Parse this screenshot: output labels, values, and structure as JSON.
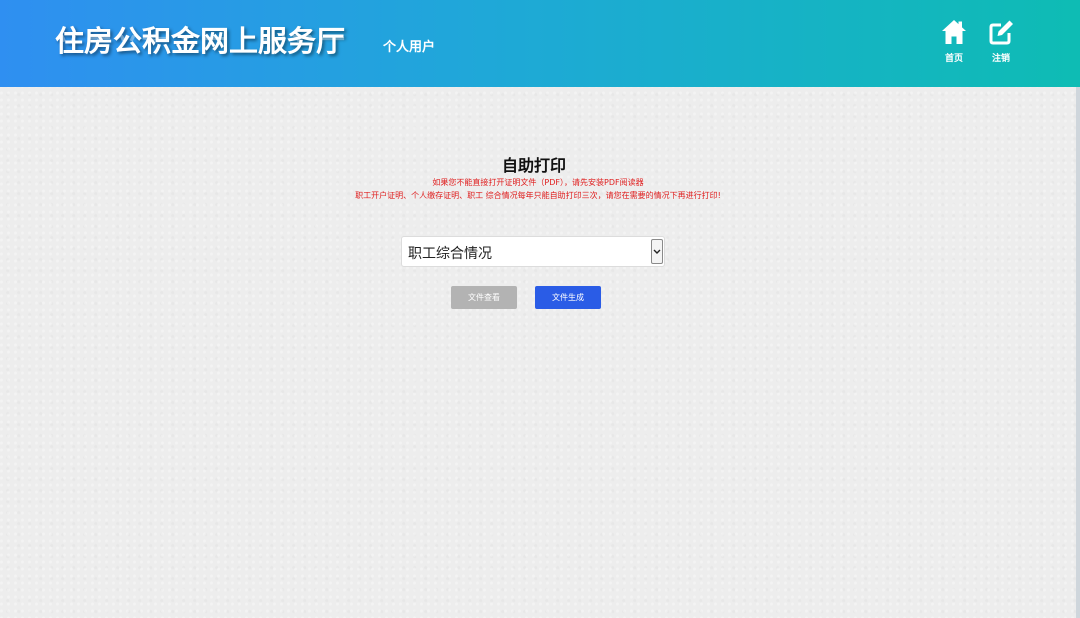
{
  "header": {
    "site_title": "住房公积金网上服务厅",
    "user_type": "个人用户",
    "nav": {
      "home_label": "首页",
      "logout_label": "注销"
    },
    "colors": {
      "gradient_start": "#2f8ff1",
      "gradient_end": "#0ebcb4"
    }
  },
  "main": {
    "title": "自助打印",
    "notice_1": "如果您不能直接打开证明文件（PDF），请先安装PDF阅读器",
    "notice_2": "职工开户证明、个人缴存证明、职工 综合情况每年只能自助打印三次，请您在需要的情况下再进行打印!",
    "notice_color": "#e02020",
    "doc_select": {
      "selected": "职工综合情况"
    },
    "buttons": {
      "view_label": "文件查看",
      "generate_label": "文件生成"
    },
    "button_colors": {
      "view": "#b3b3b3",
      "generate": "#2a5ce6"
    }
  },
  "icons": {
    "home": "home-icon",
    "logout": "edit-icon",
    "dropdown": "chevron-down-icon"
  }
}
